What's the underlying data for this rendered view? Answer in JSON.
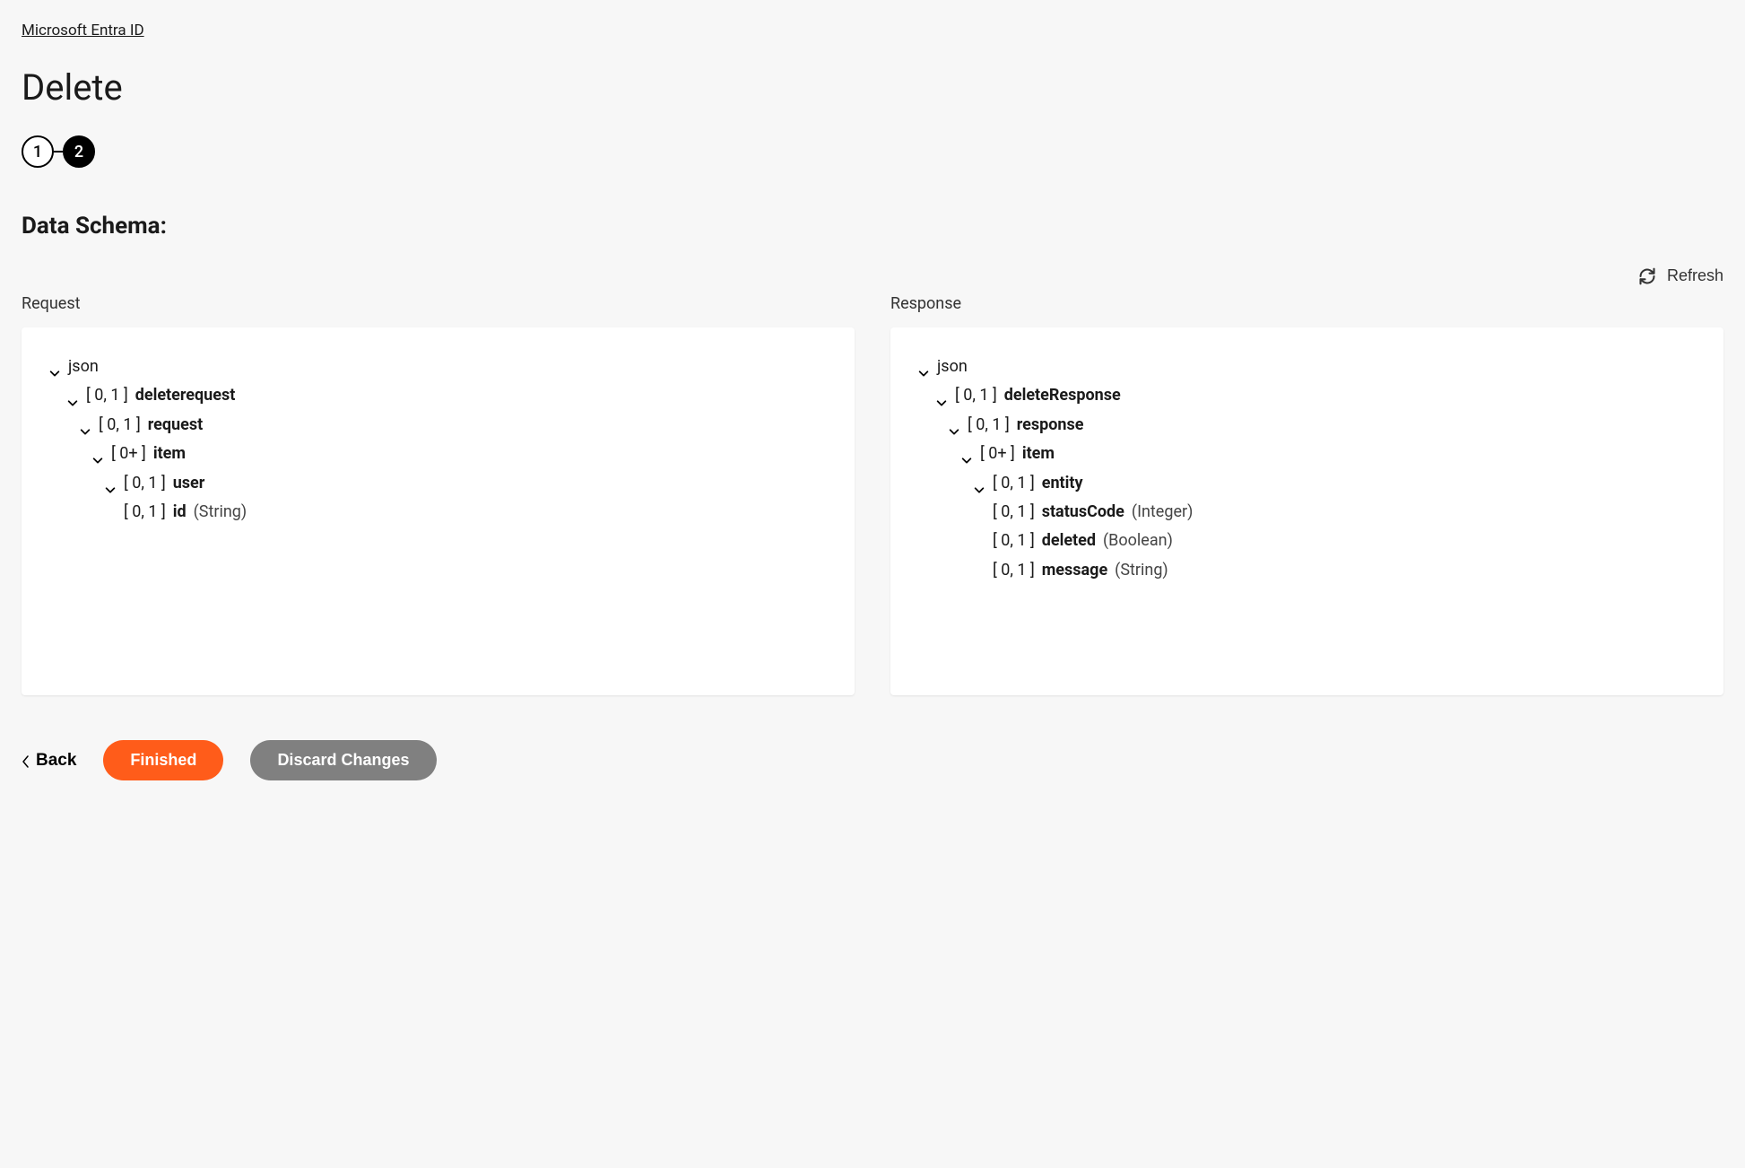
{
  "breadcrumb": "Microsoft Entra ID",
  "page_title": "Delete",
  "stepper": {
    "step1": "1",
    "step2": "2"
  },
  "section_heading": "Data Schema:",
  "refresh_label": "Refresh",
  "request": {
    "label": "Request",
    "root": "json",
    "l1_card": "[ 0, 1 ]",
    "l1_name": "deleterequest",
    "l2_card": "[ 0, 1 ]",
    "l2_name": "request",
    "l3_card": "[ 0+ ]",
    "l3_name": "item",
    "l4_card": "[ 0, 1 ]",
    "l4_name": "user",
    "l5_card": "[ 0, 1 ]",
    "l5_name": "id",
    "l5_type": "(String)"
  },
  "response": {
    "label": "Response",
    "root": "json",
    "l1_card": "[ 0, 1 ]",
    "l1_name": "deleteResponse",
    "l2_card": "[ 0, 1 ]",
    "l2_name": "response",
    "l3_card": "[ 0+ ]",
    "l3_name": "item",
    "l4_card": "[ 0, 1 ]",
    "l4_name": "entity",
    "l5a_card": "[ 0, 1 ]",
    "l5a_name": "statusCode",
    "l5a_type": "(Integer)",
    "l5b_card": "[ 0, 1 ]",
    "l5b_name": "deleted",
    "l5b_type": "(Boolean)",
    "l5c_card": "[ 0, 1 ]",
    "l5c_name": "message",
    "l5c_type": "(String)"
  },
  "footer": {
    "back": "Back",
    "finished": "Finished",
    "discard": "Discard Changes"
  }
}
